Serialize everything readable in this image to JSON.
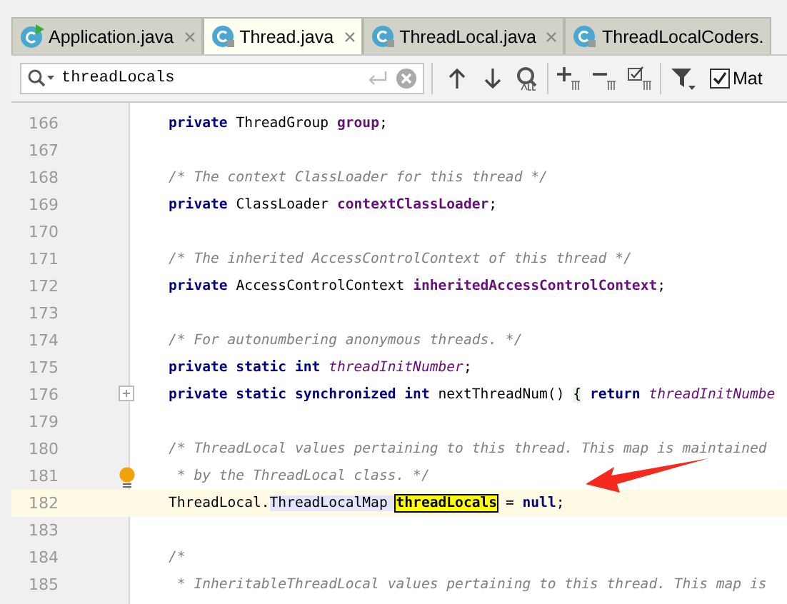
{
  "tabs": [
    {
      "label": "Application.java",
      "selected": false,
      "kind": "runnable"
    },
    {
      "label": "Thread.java",
      "selected": true,
      "kind": "class"
    },
    {
      "label": "ThreadLocal.java",
      "selected": false,
      "kind": "class"
    },
    {
      "label": "ThreadLocalCoders.",
      "selected": false,
      "kind": "class"
    }
  ],
  "find_bar": {
    "query": "threadLocals",
    "match_case": {
      "label": "Mat",
      "checked": true
    }
  },
  "editor": {
    "lines": [
      {
        "number": "166",
        "current": false,
        "fold_marker": false,
        "bulb": false,
        "tokens": [
          {
            "kind": "keyword",
            "text": "private"
          },
          {
            "kind": "plain",
            "text": " ThreadGroup "
          },
          {
            "kind": "field",
            "text": "group"
          },
          {
            "kind": "plain",
            "text": ";"
          }
        ]
      },
      {
        "number": "167",
        "current": false,
        "fold_marker": false,
        "bulb": false
      },
      {
        "number": "168",
        "current": false,
        "fold_marker": false,
        "bulb": false,
        "tokens": [
          {
            "kind": "comment",
            "text": "/* The context ClassLoader for this thread */"
          }
        ]
      },
      {
        "number": "169",
        "current": false,
        "fold_marker": false,
        "bulb": false,
        "tokens": [
          {
            "kind": "keyword",
            "text": "private"
          },
          {
            "kind": "plain",
            "text": " ClassLoader "
          },
          {
            "kind": "field",
            "text": "contextClassLoader"
          },
          {
            "kind": "plain",
            "text": ";"
          }
        ]
      },
      {
        "number": "170",
        "current": false,
        "fold_marker": false,
        "bulb": false
      },
      {
        "number": "171",
        "current": false,
        "fold_marker": false,
        "bulb": false,
        "tokens": [
          {
            "kind": "comment",
            "text": "/* The inherited AccessControlContext of this thread */"
          }
        ]
      },
      {
        "number": "172",
        "current": false,
        "fold_marker": false,
        "bulb": false,
        "tokens": [
          {
            "kind": "keyword",
            "text": "private"
          },
          {
            "kind": "plain",
            "text": " AccessControlContext "
          },
          {
            "kind": "field",
            "text": "inheritedAccessControlContext"
          },
          {
            "kind": "plain",
            "text": ";"
          }
        ]
      },
      {
        "number": "173",
        "current": false,
        "fold_marker": false,
        "bulb": false
      },
      {
        "number": "174",
        "current": false,
        "fold_marker": false,
        "bulb": false,
        "tokens": [
          {
            "kind": "comment",
            "text": "/* For autonumbering anonymous threads. */"
          }
        ]
      },
      {
        "number": "175",
        "current": false,
        "fold_marker": false,
        "bulb": false,
        "tokens": [
          {
            "kind": "keyword",
            "text": "private static int "
          },
          {
            "kind": "static",
            "text": "threadInitNumber"
          },
          {
            "kind": "plain",
            "text": ";"
          }
        ]
      },
      {
        "number": "176",
        "current": false,
        "fold_marker": true,
        "bulb": false,
        "tokens": [
          {
            "kind": "keyword",
            "text": "private static synchronized int"
          },
          {
            "kind": "plain",
            "text": " nextThreadNum() "
          },
          {
            "kind": "brace",
            "text": "{"
          },
          {
            "kind": "keyword",
            "text": " return "
          },
          {
            "kind": "static",
            "text": "threadInitNumbe"
          }
        ]
      },
      {
        "number": "179",
        "current": false,
        "fold_marker": false,
        "bulb": false
      },
      {
        "number": "180",
        "current": false,
        "fold_marker": false,
        "bulb": false,
        "tokens": [
          {
            "kind": "comment",
            "text": "/* ThreadLocal values pertaining to this thread. This map is maintained"
          }
        ]
      },
      {
        "number": "181",
        "current": false,
        "fold_marker": false,
        "bulb": true,
        "tokens": [
          {
            "kind": "comment",
            "text": " * by the ThreadLocal class. */"
          }
        ]
      },
      {
        "number": "182",
        "current": true,
        "fold_marker": false,
        "bulb": false,
        "tokens": [
          {
            "kind": "plain",
            "text": "ThreadLocal."
          },
          {
            "kind": "usage",
            "text": "ThreadLocalMap "
          },
          {
            "kind": "match",
            "text": "threadLocals"
          },
          {
            "kind": "plain",
            "text": " = "
          },
          {
            "kind": "keyword",
            "text": "null"
          },
          {
            "kind": "plain",
            "text": ";"
          }
        ]
      },
      {
        "number": "183",
        "current": false,
        "fold_marker": false,
        "bulb": false
      },
      {
        "number": "184",
        "current": false,
        "fold_marker": false,
        "bulb": false,
        "tokens": [
          {
            "kind": "comment",
            "text": "/*"
          }
        ]
      },
      {
        "number": "185",
        "current": false,
        "fold_marker": false,
        "bulb": false,
        "tokens": [
          {
            "kind": "comment",
            "text": " * InheritableThreadLocal values pertaining to this thread. This map is"
          }
        ]
      }
    ]
  }
}
